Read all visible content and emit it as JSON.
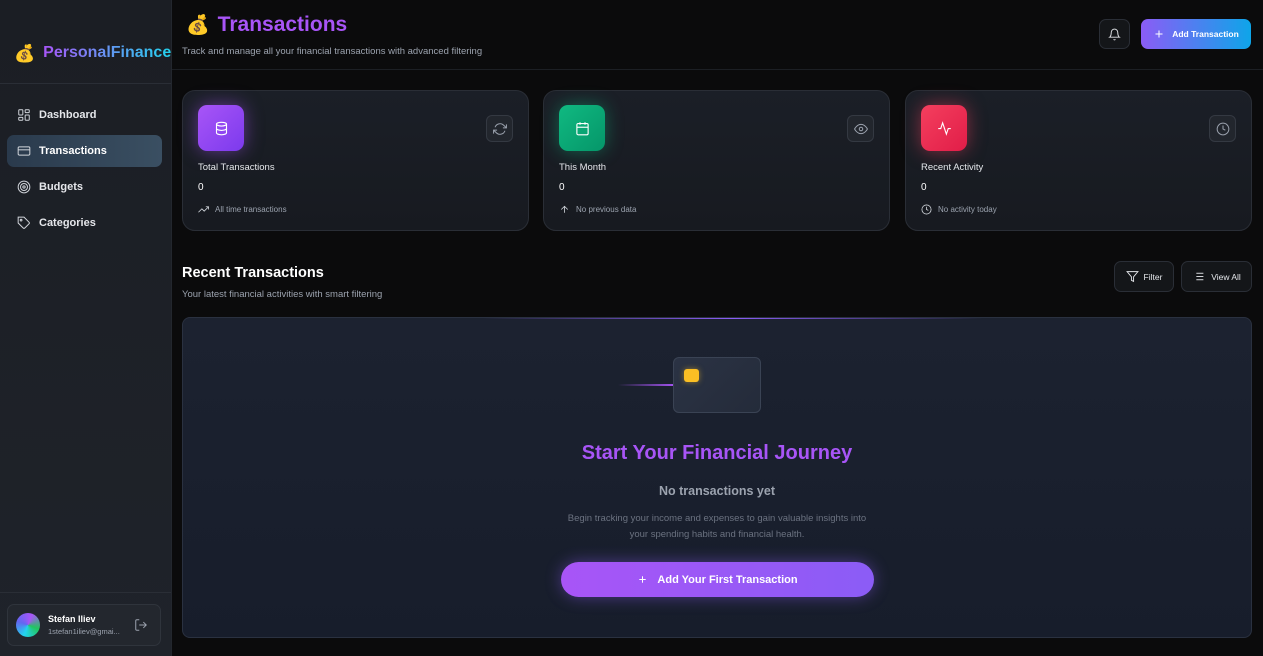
{
  "brand": {
    "icon": "💰",
    "name": "PersonalFinance"
  },
  "sidebar": {
    "items": [
      {
        "label": "Dashboard",
        "icon": "grid-icon",
        "active": false
      },
      {
        "label": "Transactions",
        "icon": "credit-card-icon",
        "active": true
      },
      {
        "label": "Budgets",
        "icon": "target-icon",
        "active": false
      },
      {
        "label": "Categories",
        "icon": "tag-icon",
        "active": false
      }
    ],
    "user": {
      "name": "Stefan Iliev",
      "email": "1stefan1iliev@gmai..."
    }
  },
  "header": {
    "title_icon": "💰",
    "title": "Transactions",
    "subtitle": "Track and manage all your financial transactions with advanced filtering",
    "add_button": "Add Transaction"
  },
  "stats": [
    {
      "label": "Total Transactions",
      "value": "0",
      "note": "All time transactions",
      "icon": "database-icon",
      "action_icon": "refresh-icon",
      "note_icon": "trending-up-icon",
      "color": "#a855f7"
    },
    {
      "label": "This Month",
      "value": "0",
      "note": "No previous data",
      "icon": "calendar-icon",
      "action_icon": "eye-icon",
      "note_icon": "arrow-up-icon",
      "color": "#10b981"
    },
    {
      "label": "Recent Activity",
      "value": "0",
      "note": "No activity today",
      "icon": "activity-icon",
      "action_icon": "clock-icon",
      "note_icon": "clock-icon",
      "color": "#f43f5e"
    }
  ],
  "recent": {
    "title": "Recent Transactions",
    "subtitle": "Your latest financial activities with smart filtering",
    "filter_label": "Filter",
    "view_all_label": "View All"
  },
  "empty_state": {
    "title": "Start Your Financial Journey",
    "subtitle": "No transactions yet",
    "description": "Begin tracking your income and expenses to gain valuable insights into your spending habits and financial health.",
    "button": "Add Your First Transaction"
  },
  "colors": {
    "accent": "#a855f7",
    "accent_secondary": "#0ea5e9",
    "background": "#0b0b0c"
  }
}
